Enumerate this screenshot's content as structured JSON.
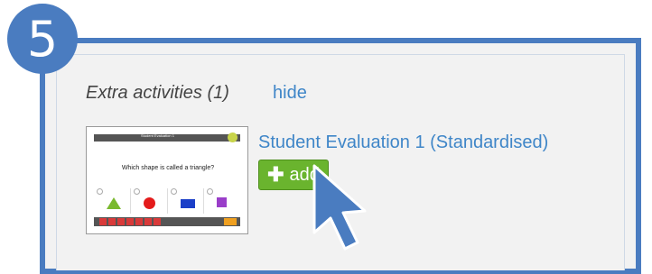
{
  "step": {
    "number": "5"
  },
  "section": {
    "title": "Extra activities (1)",
    "hide_label": "hide"
  },
  "activity": {
    "title": "Student Evaluation 1 (Standardised)",
    "add_label": "add",
    "thumbnail": {
      "header_title": "Student Evaluation 1",
      "question": "Which shape is called a triangle?"
    }
  },
  "colors": {
    "accent": "#4a7cc0",
    "link": "#3f86c8",
    "add_button": "#6ab42e"
  },
  "icons": [
    "plus-icon",
    "mouse-pointer-icon"
  ]
}
